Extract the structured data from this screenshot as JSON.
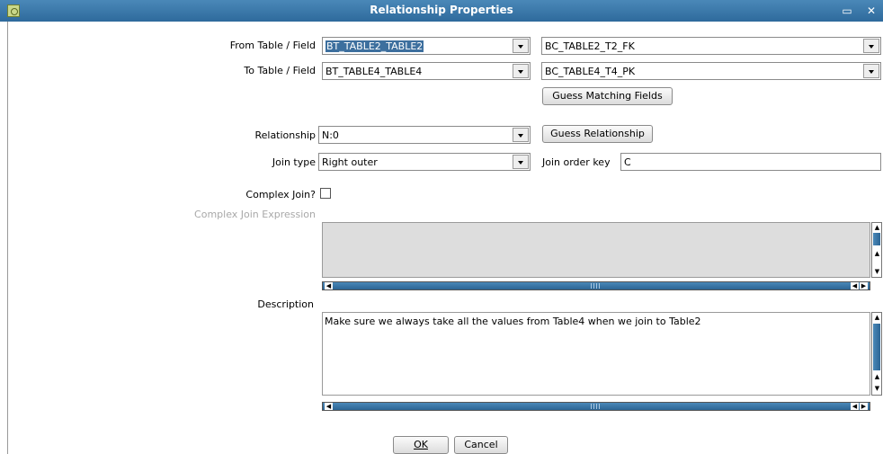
{
  "window": {
    "title": "Relationship Properties"
  },
  "from": {
    "label": "From Table / Field",
    "table": "BT_TABLE2_TABLE2",
    "field": "BC_TABLE2_T2_FK"
  },
  "to": {
    "label": "To Table / Field",
    "table": "BT_TABLE4_TABLE4",
    "field": "BC_TABLE4_T4_PK"
  },
  "guess_fields_label": "Guess Matching Fields",
  "relationship": {
    "label": "Relationship",
    "value": "N:0",
    "guess_label": "Guess Relationship"
  },
  "join": {
    "label": "Join type",
    "value": "Right outer",
    "order_key_label": "Join order key",
    "order_key_value": "C"
  },
  "complex": {
    "label": "Complex Join?",
    "checked": false,
    "expr_label": "Complex Join Expression",
    "expr_value": ""
  },
  "description": {
    "label": "Description",
    "value": "Make sure we always take all the values from Table4 when we join to Table2"
  },
  "buttons": {
    "ok": "OK",
    "cancel": "Cancel"
  },
  "colors": {
    "titlebar": "#2e6a9c",
    "selection": "#3d6f9e",
    "scroll_thumb": "#3a78aa"
  }
}
